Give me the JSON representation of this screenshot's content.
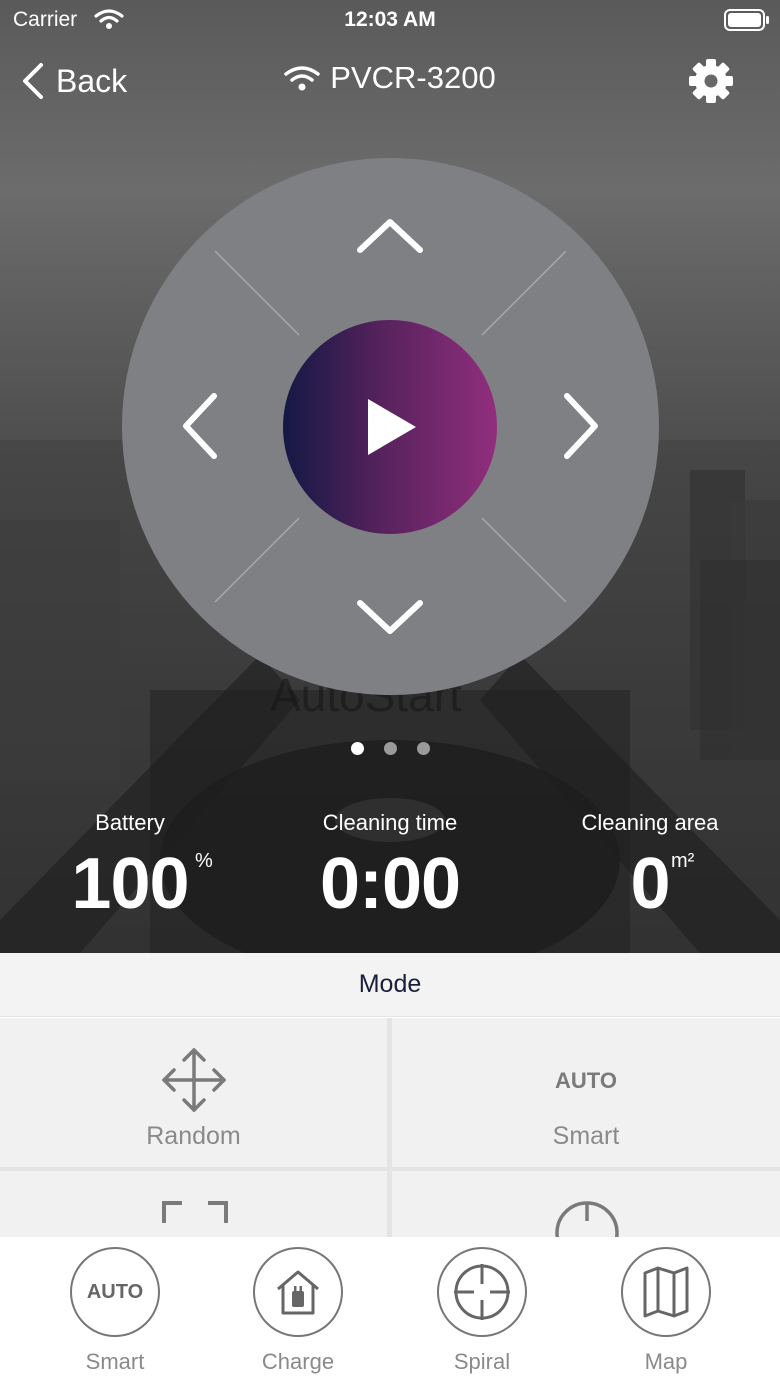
{
  "status_bar": {
    "carrier": "Carrier",
    "time": "12:03 AM"
  },
  "nav": {
    "back_label": "Back",
    "title": "PVCR-3200"
  },
  "pager": {
    "count": 3,
    "active_index": 0
  },
  "stats": {
    "battery": {
      "label": "Battery",
      "value": "100",
      "unit": "%"
    },
    "cleaning_time": {
      "label": "Cleaning time",
      "value": "0:00"
    },
    "cleaning_area": {
      "label": "Cleaning area",
      "value": "0",
      "unit": "m²"
    }
  },
  "mode": {
    "header": "Mode",
    "items": [
      {
        "label": "Random",
        "icon": "move-arrows-icon"
      },
      {
        "label": "Smart",
        "icon_text": "AUTO"
      }
    ]
  },
  "tabs": [
    {
      "label": "Smart",
      "icon_text": "AUTO"
    },
    {
      "label": "Charge",
      "icon": "home-charge-icon"
    },
    {
      "label": "Spiral",
      "icon": "crosshair-icon"
    },
    {
      "label": "Map",
      "icon": "map-icon"
    }
  ],
  "colors": {
    "play_gradient": [
      "#141845",
      "#912e7d"
    ],
    "dpad": "#7f8084",
    "mode_title": "#1b1f3b"
  }
}
